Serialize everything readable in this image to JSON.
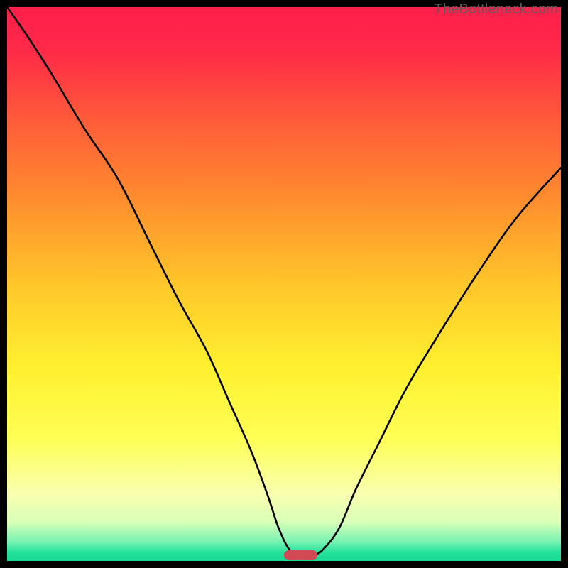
{
  "attribution": "TheBottleneck.com",
  "colors": {
    "frame": "#000000",
    "marker": "#d24a53",
    "curve": "#000000",
    "gradient_stops": [
      {
        "pos": 0.0,
        "color": "#ff1f4b"
      },
      {
        "pos": 0.08,
        "color": "#ff2a48"
      },
      {
        "pos": 0.2,
        "color": "#ff5a3a"
      },
      {
        "pos": 0.35,
        "color": "#ff8e2e"
      },
      {
        "pos": 0.5,
        "color": "#ffc62a"
      },
      {
        "pos": 0.65,
        "color": "#fff02f"
      },
      {
        "pos": 0.78,
        "color": "#ffff55"
      },
      {
        "pos": 0.88,
        "color": "#f8ffb0"
      },
      {
        "pos": 0.93,
        "color": "#d8ffb8"
      },
      {
        "pos": 0.965,
        "color": "#79f3b2"
      },
      {
        "pos": 0.985,
        "color": "#22e19b"
      },
      {
        "pos": 1.0,
        "color": "#17d993"
      }
    ]
  },
  "chart_data": {
    "type": "line",
    "title": "",
    "xlabel": "",
    "ylabel": "",
    "xlim": [
      0,
      100
    ],
    "ylim": [
      0,
      100
    ],
    "series": [
      {
        "name": "bottleneck-curve",
        "x": [
          0,
          3.5,
          8,
          14,
          20,
          26,
          31,
          36,
          40,
          44,
          47,
          49,
          51,
          53,
          55,
          57,
          60,
          63,
          67,
          72,
          78,
          85,
          92,
          100
        ],
        "values": [
          100,
          95,
          88,
          78,
          69,
          57,
          47,
          38,
          29,
          20,
          12,
          6,
          2,
          1,
          1,
          2,
          6,
          13,
          21,
          31,
          41,
          52,
          62,
          71
        ]
      }
    ],
    "marker": {
      "x_center": 53,
      "width_pct": 6,
      "y": 1
    }
  }
}
